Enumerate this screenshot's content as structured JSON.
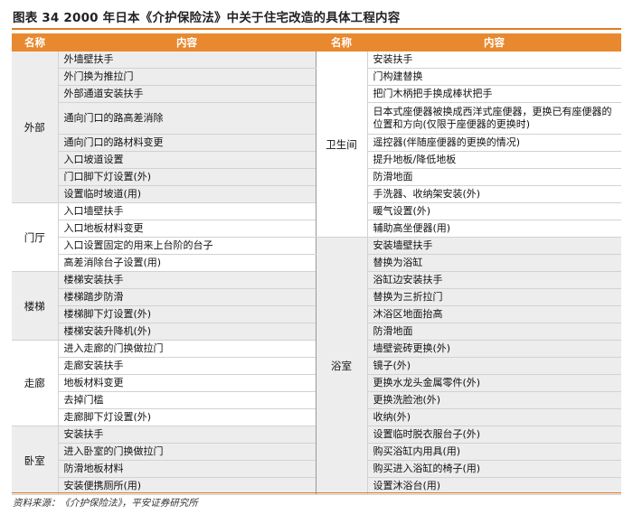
{
  "title": "图表 34   2000 年日本《介护保险法》中关于住宅改造的具体工程内容",
  "headers": {
    "col_name_left": "名称",
    "col_content_left": "内容",
    "col_name_right": "名称",
    "col_content_right": "内容"
  },
  "categories_left": [
    "外部",
    "门厅",
    "楼梯",
    "走廊",
    "卧室"
  ],
  "categories_right": [
    "卫生间",
    "浴室"
  ],
  "left_items": [
    "外墙壁扶手",
    "外门换为推拉门",
    "外部通道安装扶手",
    "通向门口的路高差消除",
    "通向门口的路材料变更",
    "入口坡道设置",
    "门口脚下灯设置(外)",
    "设置临时坡道(用)",
    "入口墙壁扶手",
    "入口地板材料变更",
    "入口设置固定的用来上台阶的台子",
    "高差消除台子设置(用)",
    "楼梯安装扶手",
    "楼梯踏步防滑",
    "楼梯脚下灯设置(外)",
    "楼梯安装升降机(外)",
    "进入走廊的门换做拉门",
    "走廊安装扶手",
    "地板材料变更",
    "去掉门槛",
    "走廊脚下灯设置(外)",
    "安装扶手",
    "进入卧室的门换做拉门",
    "防滑地板材料",
    "安装便携厕所(用)"
  ],
  "right_items": [
    "安装扶手",
    "门构建替换",
    "把门木柄把手换成棒状把手",
    "日本式座便器被换成西洋式座便器，更换已有座便器的位置和方向(仅限于座便器的更换时)",
    "遥控器(伴随座便器的更换的情况)",
    "提升地板/降低地板",
    "防滑地面",
    "手洗器、收纳架安装(外)",
    "暖气设置(外)",
    "辅助高坐便器(用)",
    "安装墙壁扶手",
    "替换为浴缸",
    "浴缸边安装扶手",
    "替换为三折拉门",
    "沐浴区地面抬高",
    "防滑地面",
    "墙壁瓷砖更换(外)",
    "镜子(外)",
    "更换水龙头金属零件(外)",
    "更换洗脸池(外)",
    "收纳(外)",
    "设置临时脱衣服台子(外)",
    "购买浴缸内用具(用)",
    "购买进入浴缸的椅子(用)",
    "设置沐浴台(用)"
  ],
  "source": "资料来源：《介护保险法》，平安证券研究所"
}
